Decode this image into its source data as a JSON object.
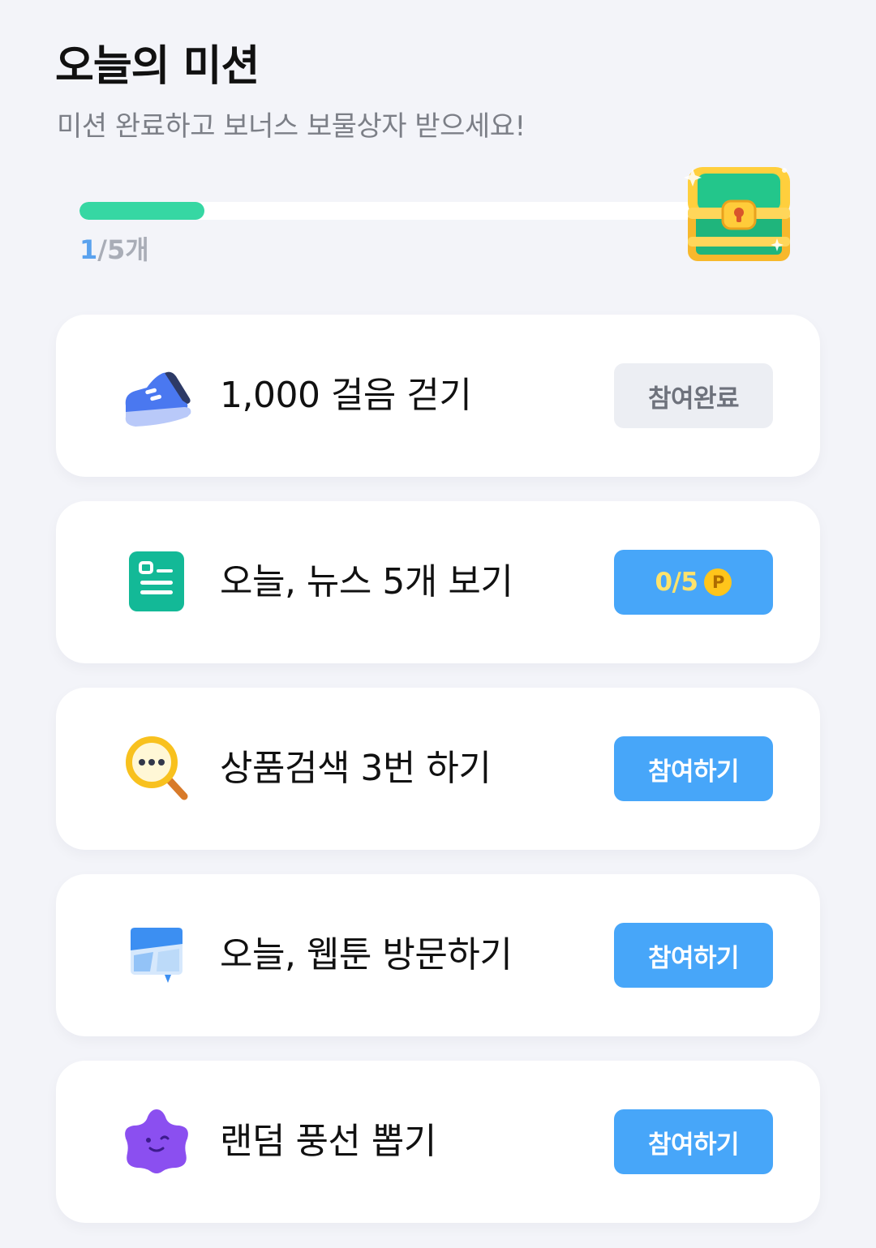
{
  "header": {
    "title": "오늘의 미션",
    "subtitle": "미션 완료하고 보너스 보물상자 받으세요!"
  },
  "progress": {
    "completed": "1",
    "total_text": "/5개",
    "fraction": 0.2,
    "fill_color": "#36d7a3",
    "reward_icon": "treasure-chest-icon"
  },
  "missions": [
    {
      "title": "1,000 걸음 걷기",
      "icon": "sneaker-icon",
      "button_label": "참여완료",
      "state": "done"
    },
    {
      "title": "오늘, 뉴스 5개 보기",
      "icon": "news-icon",
      "button_label": "0/5",
      "button_badge": "P",
      "state": "in-progress"
    },
    {
      "title": "상품검색 3번 하기",
      "icon": "search-icon",
      "button_label": "참여하기",
      "state": "todo"
    },
    {
      "title": "오늘, 웹툰 방문하기",
      "icon": "webtoon-icon",
      "button_label": "참여하기",
      "state": "todo"
    },
    {
      "title": "랜덤 풍선 뽑기",
      "icon": "star-balloon-icon",
      "button_label": "참여하기",
      "state": "todo"
    }
  ],
  "colors": {
    "accent_button": "#47a6f9",
    "done_button": "#eceef3",
    "background": "#f3f4f9"
  }
}
